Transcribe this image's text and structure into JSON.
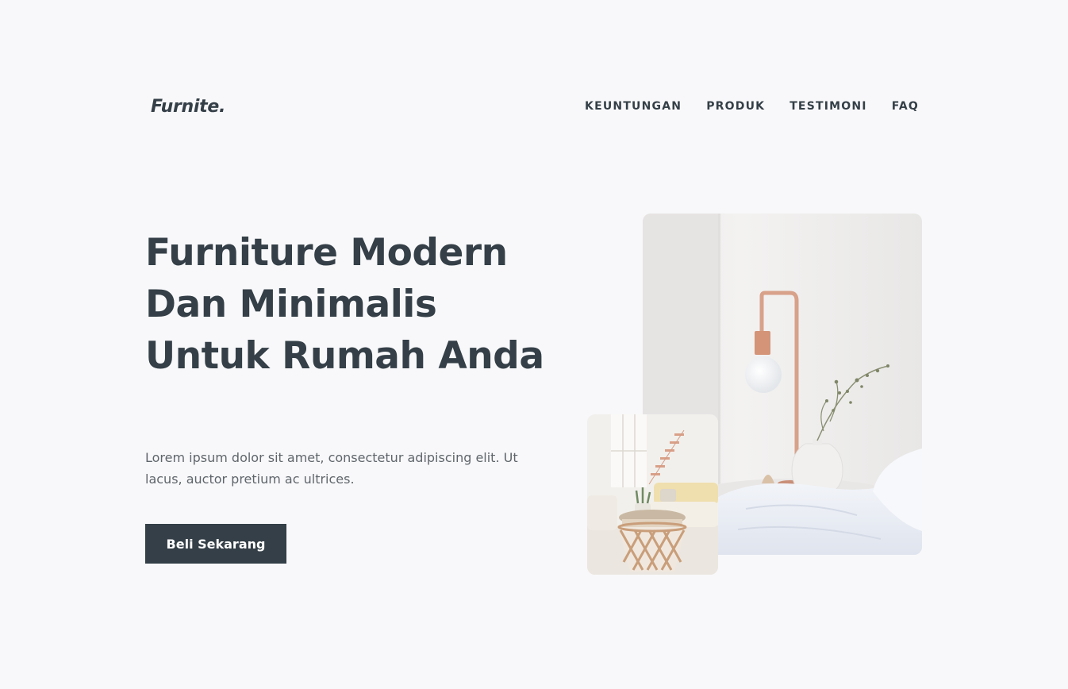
{
  "brand": {
    "logo": "Furnite."
  },
  "nav": {
    "items": [
      {
        "label": "KEUNTUNGAN"
      },
      {
        "label": "PRODUK"
      },
      {
        "label": "TESTIMONI"
      },
      {
        "label": "FAQ"
      }
    ]
  },
  "hero": {
    "title": "Furniture Modern Dan Minimalis Untuk Rumah Anda",
    "description": "Lorem ipsum dolor sit amet, consectetur adipiscing elit. Ut lacus, auctor pretium ac ultrices.",
    "cta_label": "Beli Sekarang"
  },
  "colors": {
    "primary": "#343f47",
    "background": "#f8f8fa",
    "text_muted": "#5f666b"
  }
}
